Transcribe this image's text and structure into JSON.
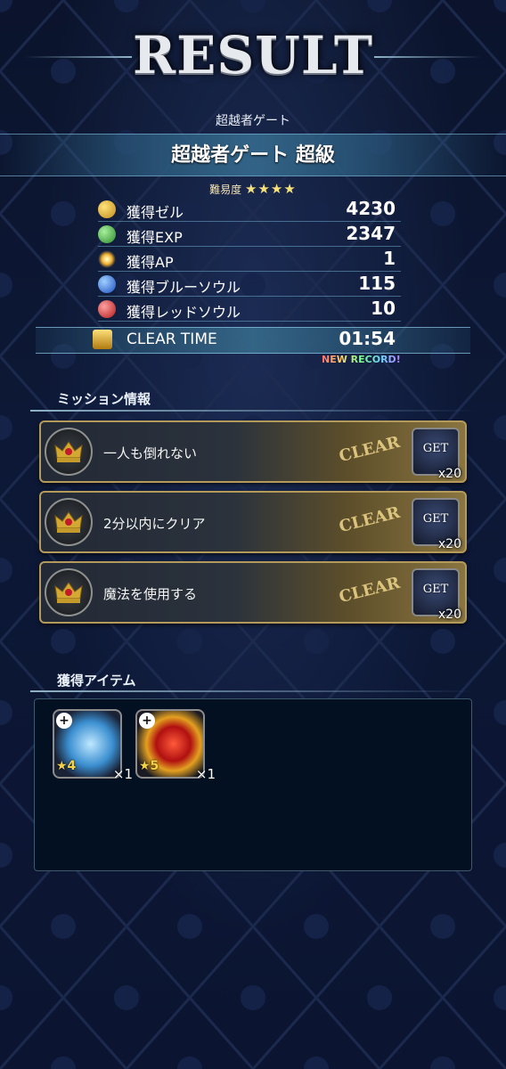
{
  "screen": {
    "title": "RESULT",
    "gate_name": "超越者ゲート",
    "quest_title": "超越者ゲート 超級",
    "difficulty_label": "難易度",
    "difficulty_stars": "★★★★"
  },
  "rewards": [
    {
      "icon": "gil-coin-icon",
      "label": "獲得ゼル",
      "value": "4230",
      "color": "#d5a52c"
    },
    {
      "icon": "exp-icon",
      "label": "獲得EXP",
      "value": "2347",
      "color": "#4bb34b"
    },
    {
      "icon": "ap-spark-icon",
      "label": "獲得AP",
      "value": "1",
      "color": "#f0c050"
    },
    {
      "icon": "blue-soul-icon",
      "label": "獲得ブルーソウル",
      "value": "115",
      "color": "#2b6fe0"
    },
    {
      "icon": "red-soul-icon",
      "label": "獲得レッドソウル",
      "value": "10",
      "color": "#d2262b"
    }
  ],
  "clear_time": {
    "label": "CLEAR TIME",
    "value": "01:54",
    "new_record": "NEW RECORD!"
  },
  "missions": {
    "title": "ミッション情報",
    "items": [
      {
        "text": "一人も倒れない",
        "status": "CLEAR",
        "reward_label": "GET",
        "reward_count": "x20"
      },
      {
        "text": "2分以内にクリア",
        "status": "CLEAR",
        "reward_label": "GET",
        "reward_count": "x20"
      },
      {
        "text": "魔法を使用する",
        "status": "CLEAR",
        "reward_label": "GET",
        "reward_count": "x20"
      }
    ]
  },
  "acquired_items": {
    "title": "獲得アイテム",
    "items": [
      {
        "icon": "blue-crystal-item-icon",
        "rarity": "★4",
        "quantity": "×1",
        "badge": "+"
      },
      {
        "icon": "red-eye-item-icon",
        "rarity": "★5",
        "quantity": "×1",
        "badge": "+"
      }
    ]
  },
  "colors": {
    "background": "#0b142c",
    "accent_line": "#8fb5c9",
    "mission_gold": "#b49a5a",
    "star": "#f6e27a"
  }
}
